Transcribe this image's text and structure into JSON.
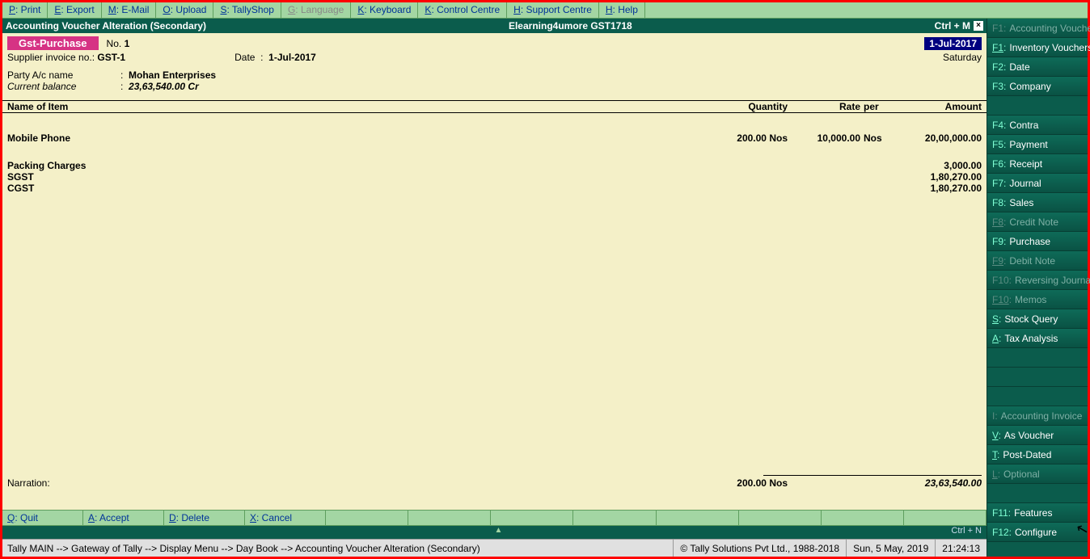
{
  "top_menu": [
    {
      "key": "P",
      "label": "Print",
      "enabled": true
    },
    {
      "key": "E",
      "label": "Export",
      "enabled": true
    },
    {
      "key": "M",
      "label": "E-Mail",
      "enabled": true
    },
    {
      "key": "O",
      "label": "Upload",
      "enabled": true
    },
    {
      "key": "S",
      "label": "TallyShop",
      "enabled": true
    },
    {
      "key": "G",
      "label": "Language",
      "enabled": false
    },
    {
      "key": "K",
      "label": "Keyboard",
      "enabled": true
    },
    {
      "key": "K",
      "label": "Control Centre",
      "enabled": true
    },
    {
      "key": "H",
      "label": "Support Centre",
      "enabled": true
    },
    {
      "key": "H",
      "label": "Help",
      "enabled": true
    }
  ],
  "title": {
    "left": "Accounting Voucher  Alteration  (Secondary)",
    "center": "Elearning4umore GST1718",
    "right": "Ctrl + M"
  },
  "voucher": {
    "type": "Gst-Purchase",
    "no_label": "No.",
    "no_value": "1",
    "supplier_lbl": "Supplier invoice no.:",
    "supplier_val": "GST-1",
    "date_lbl": "Date",
    "date_sep": ":",
    "date_val": "1-Jul-2017",
    "hdr_date": "1-Jul-2017",
    "hdr_day": "Saturday",
    "party_lbl": "Party A/c name",
    "party_sep": ":",
    "party_val": "Mohan Enterprises",
    "balance_lbl": "Current balance",
    "balance_sep": ":",
    "balance_val": "23,63,540.00 Cr"
  },
  "cols": {
    "item": "Name of Item",
    "qty": "Quantity",
    "rate": "Rate",
    "per": "per",
    "amt": "Amount"
  },
  "items": [
    {
      "name": "Mobile Phone",
      "qty": "200.00 Nos",
      "rate": "10,000.00",
      "per": "Nos",
      "amt": "20,00,000.00"
    }
  ],
  "ledgers": [
    {
      "name": "Packing Charges",
      "amt": "3,000.00"
    },
    {
      "name": "SGST",
      "amt": "1,80,270.00"
    },
    {
      "name": "CGST",
      "amt": "1,80,270.00"
    }
  ],
  "narration_lbl": "Narration:",
  "total": {
    "qty": "200.00 Nos",
    "amt": "23,63,540.00"
  },
  "footer": [
    {
      "key": "Q",
      "label": "Quit"
    },
    {
      "key": "A",
      "label": "Accept"
    },
    {
      "key": "D",
      "label": "Delete"
    },
    {
      "key": "X",
      "label": "Cancel"
    }
  ],
  "ctrl_n": "Ctrl + N",
  "status": {
    "path": "Tally MAIN -->  Gateway of Tally -->  Display Menu -->  Day Book -->  Accounting Voucher  Alteration  (Secondary)",
    "copyright": "© Tally Solutions Pvt Ltd., 1988-2018",
    "date": "Sun, 5 May, 2019",
    "time": "21:24:13"
  },
  "side": [
    {
      "key": "F1:",
      "label": "Accounting Vouchers",
      "enabled": false
    },
    {
      "key": "F1:",
      "label": "Inventory Vouchers",
      "enabled": true,
      "ul": true
    },
    {
      "key": "F2:",
      "label": "Date",
      "enabled": true
    },
    {
      "key": "F3:",
      "label": "Company",
      "enabled": true
    },
    {
      "type": "spacer"
    },
    {
      "key": "F4:",
      "label": "Contra",
      "enabled": true
    },
    {
      "key": "F5:",
      "label": "Payment",
      "enabled": true
    },
    {
      "key": "F6:",
      "label": "Receipt",
      "enabled": true
    },
    {
      "key": "F7:",
      "label": "Journal",
      "enabled": true
    },
    {
      "key": "F8:",
      "label": "Sales",
      "enabled": true
    },
    {
      "key": "F8:",
      "label": "Credit Note",
      "enabled": false,
      "ul": true
    },
    {
      "key": "F9:",
      "label": "Purchase",
      "enabled": true
    },
    {
      "key": "F9:",
      "label": "Debit Note",
      "enabled": false,
      "ul": true
    },
    {
      "key": "F10:",
      "label": "Reversing Journal",
      "enabled": false
    },
    {
      "key": "F10:",
      "label": "Memos",
      "enabled": false,
      "ul": true
    },
    {
      "key": "S:",
      "label": "Stock Query",
      "enabled": true,
      "ul": true
    },
    {
      "key": "A:",
      "label": "Tax Analysis",
      "enabled": true,
      "ul": true
    },
    {
      "type": "spacer"
    },
    {
      "type": "spacer"
    },
    {
      "type": "spacer"
    },
    {
      "key": "I:",
      "label": "Accounting Invoice",
      "enabled": false
    },
    {
      "key": "V:",
      "label": "As Voucher",
      "enabled": true,
      "ul": true
    },
    {
      "key": "T:",
      "label": "Post-Dated",
      "enabled": true,
      "ul": true
    },
    {
      "key": "L:",
      "label": "Optional",
      "enabled": false,
      "ul": true
    },
    {
      "type": "spacer"
    },
    {
      "key": "F11:",
      "label": "Features",
      "enabled": true
    },
    {
      "key": "F12:",
      "label": "Configure",
      "enabled": true
    }
  ]
}
